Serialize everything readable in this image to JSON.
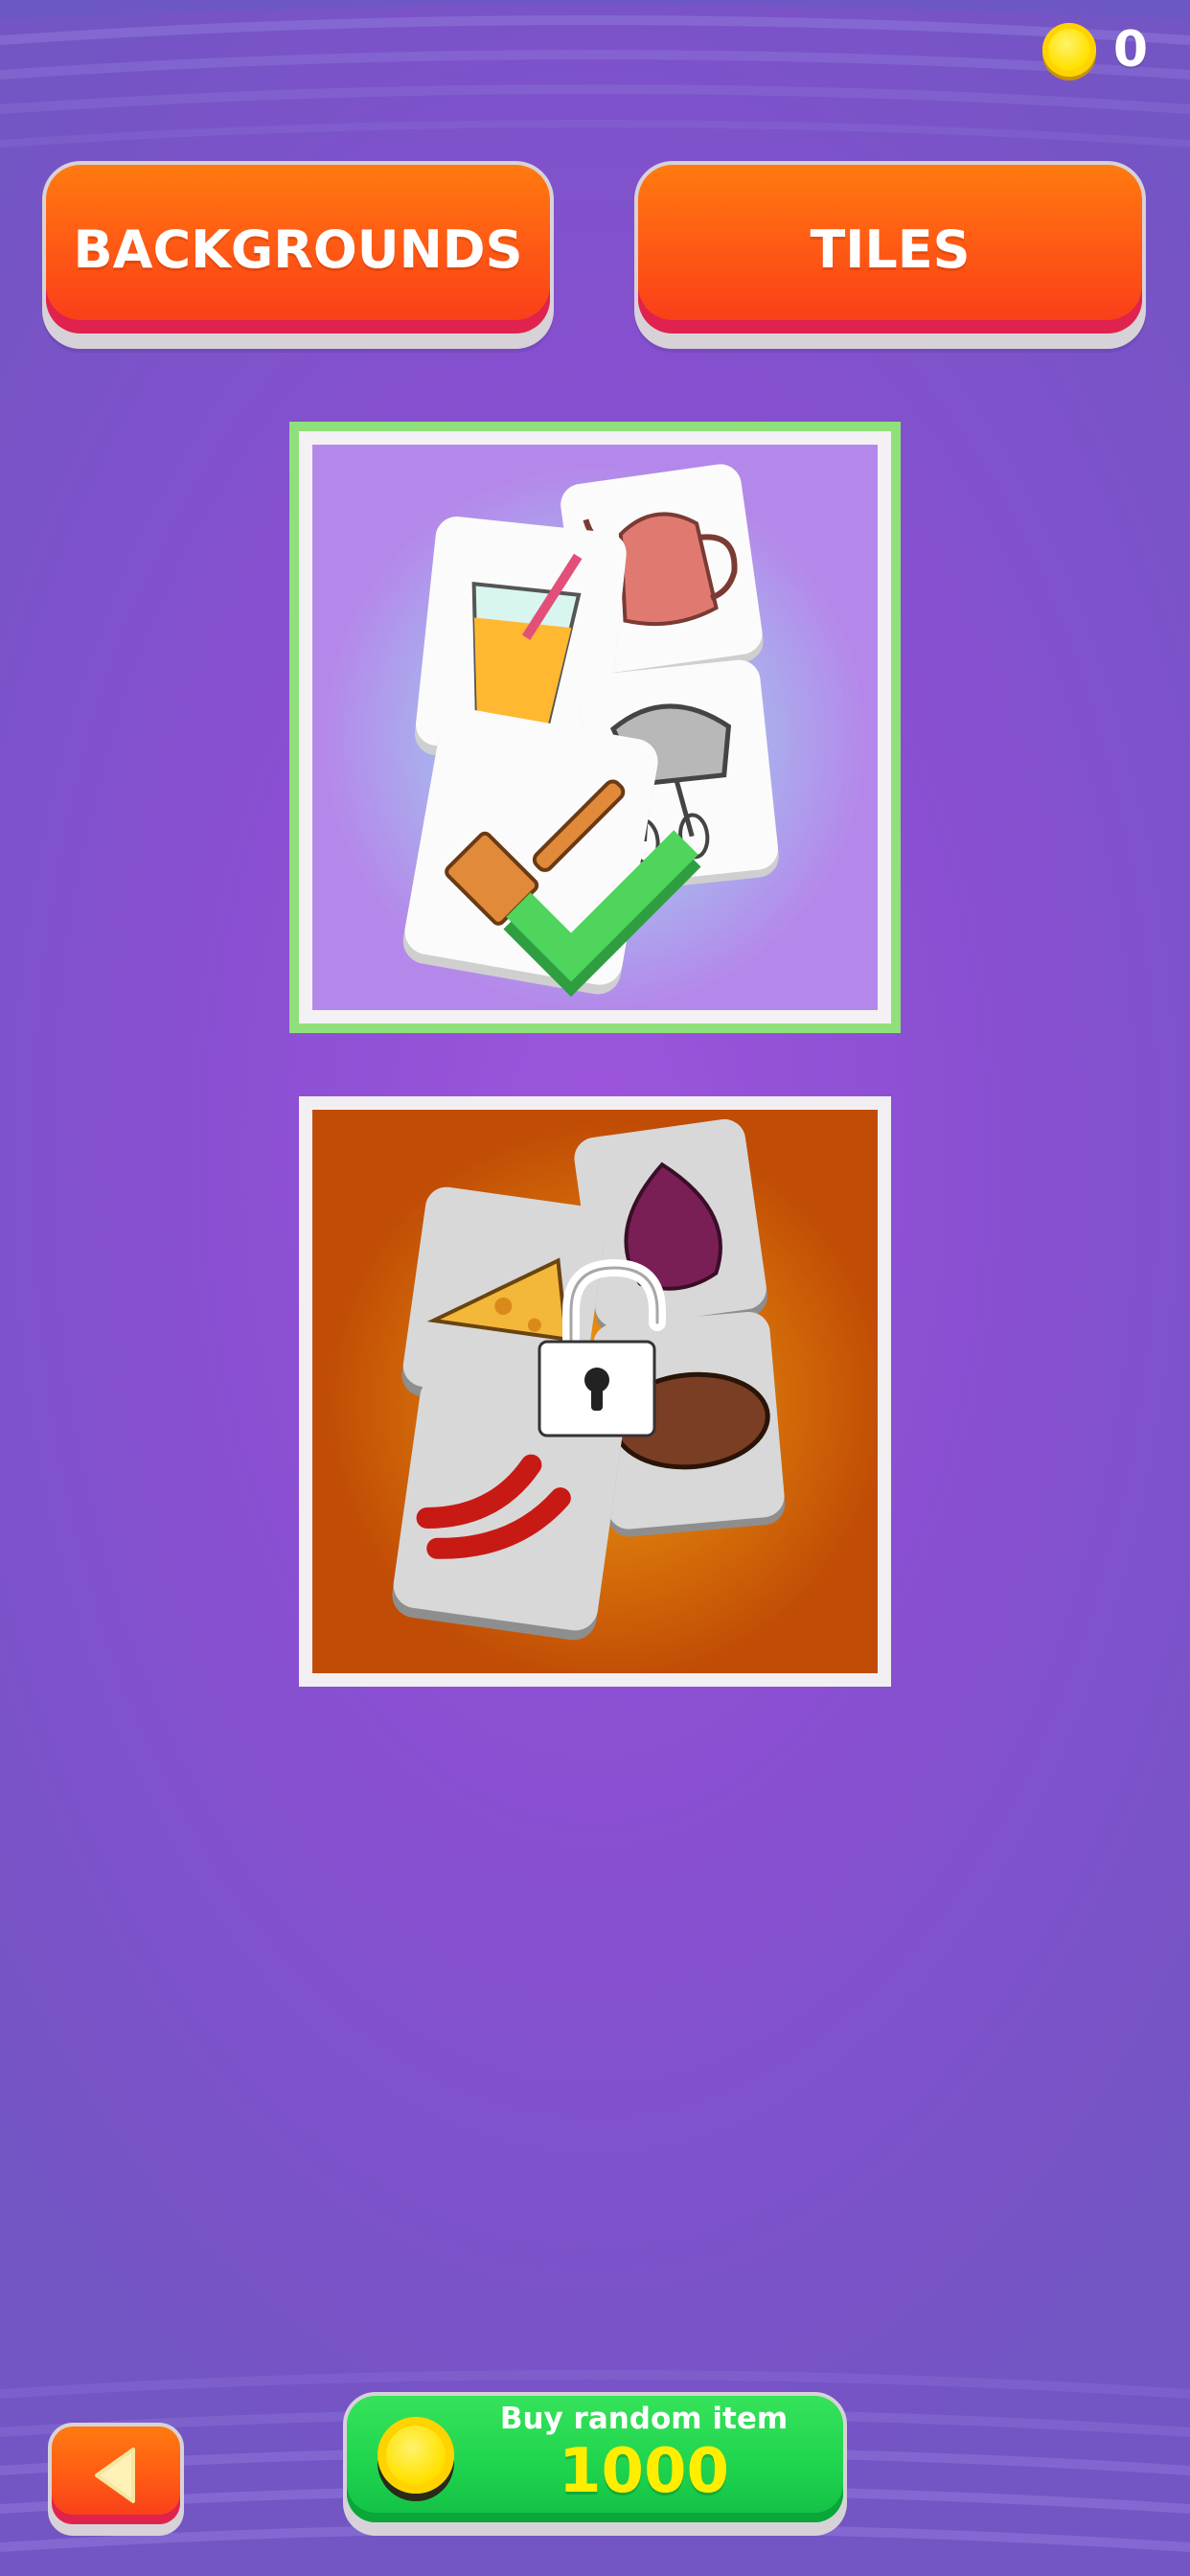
{
  "header": {
    "coins": "0"
  },
  "tabs": [
    {
      "label": "BACKGROUNDS"
    },
    {
      "label": "TILES"
    }
  ],
  "tilesets": [
    {
      "theme": "kitchen",
      "state": "selected",
      "icons": [
        "drink-glass",
        "teapot",
        "spatula",
        "hand-mixer"
      ]
    },
    {
      "theme": "food",
      "state": "locked",
      "icons": [
        "cheese",
        "onion",
        "chili-peppers",
        "meat"
      ]
    }
  ],
  "footer": {
    "buy_label": "Buy random item",
    "buy_price": "1000"
  },
  "colors": {
    "background": "#8a4fd2",
    "tab_button": "#ff5c14",
    "buy_button": "#1fd44e",
    "price_text": "#ffee00",
    "selected_border": "#8fe07a"
  }
}
